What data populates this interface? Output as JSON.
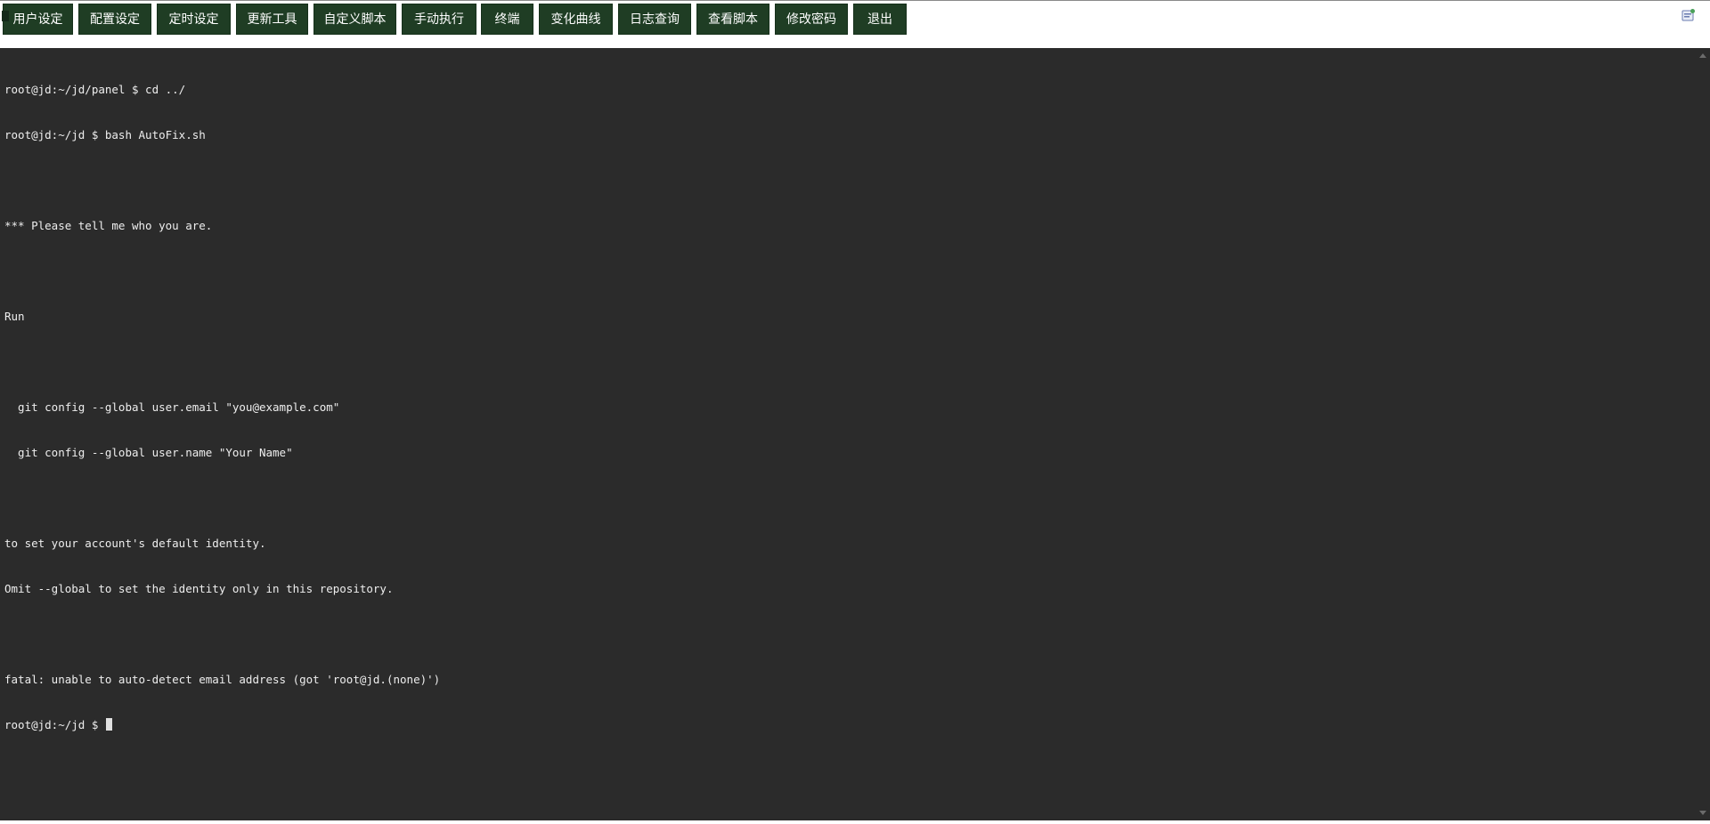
{
  "nav": {
    "buttons": [
      {
        "label": "用户设定"
      },
      {
        "label": "配置设定"
      },
      {
        "label": "定时设定"
      },
      {
        "label": "更新工具"
      },
      {
        "label": "自定义脚本"
      },
      {
        "label": "手动执行"
      },
      {
        "label": "终端"
      },
      {
        "label": "变化曲线"
      },
      {
        "label": "日志查询"
      },
      {
        "label": "查看脚本"
      },
      {
        "label": "修改密码"
      },
      {
        "label": "退出"
      }
    ]
  },
  "terminal": {
    "lines": [
      "root@jd:~/jd/panel $ cd ../",
      "root@jd:~/jd $ bash AutoFix.sh",
      "",
      "*** Please tell me who you are.",
      "",
      "Run",
      "",
      "  git config --global user.email \"you@example.com\"",
      "  git config --global user.name \"Your Name\"",
      "",
      "to set your account's default identity.",
      "Omit --global to set the identity only in this repository.",
      "",
      "fatal: unable to auto-detect email address (got 'root@jd.(none)')"
    ],
    "prompt": "root@jd:~/jd $ "
  },
  "icons": {
    "extension": "extension-icon"
  },
  "colors": {
    "nav_button_bg": "#1f3d24",
    "terminal_bg": "#2b2b2b",
    "terminal_fg": "#eeeeee"
  }
}
